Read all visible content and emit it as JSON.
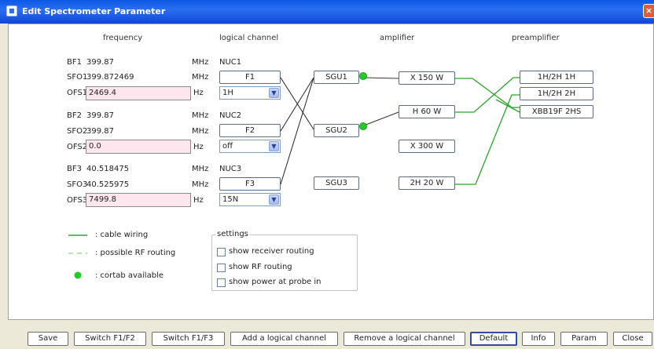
{
  "window": {
    "title": "Edit Spectrometer Parameter",
    "close_glyph": "×"
  },
  "headers": {
    "frequency": "frequency",
    "logical_channel": "logical channel",
    "amplifier": "amplifier",
    "preamplifier": "preamplifier"
  },
  "channels": [
    {
      "bf_label": "BF1",
      "bf_value": "399.87",
      "bf_unit": "MHz",
      "nuc": "NUC1",
      "sfo_label": "SFO1",
      "sfo_value": "399.872469",
      "sfo_unit": "MHz",
      "route_button": "F1",
      "ofs_label": "OFS1",
      "ofs_value": "2469.4",
      "ofs_unit": "Hz",
      "nucleus": "1H"
    },
    {
      "bf_label": "BF2",
      "bf_value": "399.87",
      "bf_unit": "MHz",
      "nuc": "NUC2",
      "sfo_label": "SFO2",
      "sfo_value": "399.87",
      "sfo_unit": "MHz",
      "route_button": "F2",
      "ofs_label": "OFS2",
      "ofs_value": "0.0",
      "ofs_unit": "Hz",
      "nucleus": "off"
    },
    {
      "bf_label": "BF3",
      "bf_value": "40.518475",
      "bf_unit": "MHz",
      "nuc": "NUC3",
      "sfo_label": "SFO3",
      "sfo_value": "40.525975",
      "sfo_unit": "MHz",
      "route_button": "F3",
      "ofs_label": "OFS3",
      "ofs_value": "7499.8",
      "ofs_unit": "Hz",
      "nucleus": "15N"
    }
  ],
  "sgu": [
    "SGU1",
    "SGU2",
    "SGU3"
  ],
  "amplifiers": [
    "X 150 W",
    "H 60 W",
    "X 300 W",
    "2H 20 W"
  ],
  "preamplifiers": [
    "1H/2H 1H",
    "1H/2H 2H",
    "XBB19F 2HS"
  ],
  "legend": {
    "cable_wiring": ": cable wiring",
    "possible_rf_routing": ": possible RF routing",
    "cortab_available": ": cortab available"
  },
  "settings": {
    "title": "settings",
    "show_receiver_routing": "show receiver routing",
    "show_rf_routing": "show RF routing",
    "show_power_at_probe_in": "show power at probe in"
  },
  "buttons": {
    "save": "Save",
    "switch_f1f2": "Switch F1/F2",
    "switch_f1f3": "Switch F1/F3",
    "add_channel": "Add a logical channel",
    "remove_channel": "Remove a logical channel",
    "default": "Default",
    "info": "Info",
    "param": "Param",
    "close": "Close"
  },
  "colors": {
    "wiring_green": "#2aa52a",
    "cortab_dot": "#22cc22",
    "field_pink": "#fde6ee",
    "routing_line": "#222222"
  },
  "icons": {
    "dropdown": "chevron-down-icon",
    "app": "app-window-icon"
  }
}
